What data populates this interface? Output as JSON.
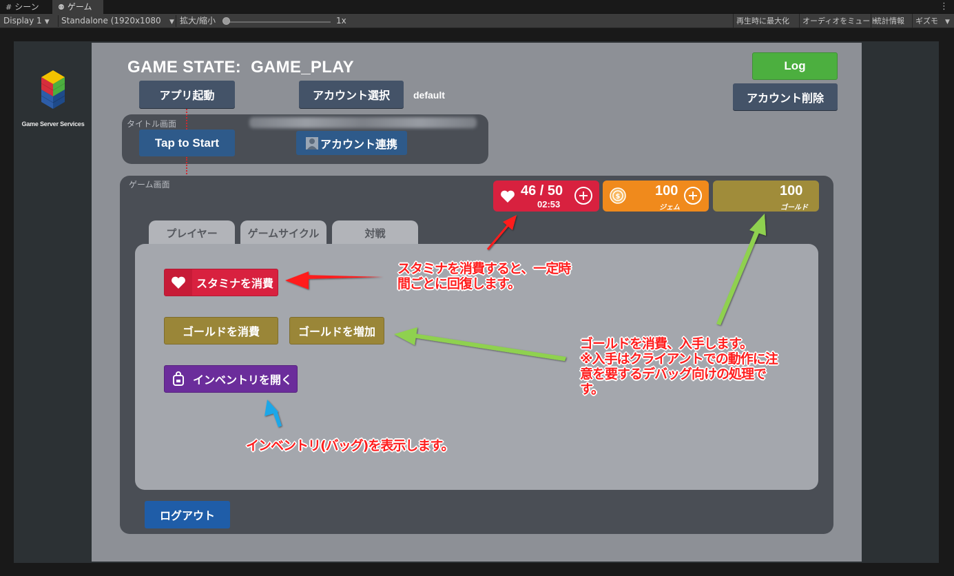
{
  "editor": {
    "tabs": [
      {
        "icon": "grid-icon",
        "label": "シーン"
      },
      {
        "icon": "gamepad-icon",
        "label": "ゲーム"
      }
    ],
    "display": "Display 1",
    "resolution": "Standalone (1920x1080",
    "zoom_label": "拡大/縮小",
    "zoom_value": "1x",
    "maximize_on_play": "再生時に最大化",
    "mute_audio": "オーディオをミュート",
    "stats": "統計情報",
    "gizmos": "ギズモ"
  },
  "sidebar": {
    "logo_label": "Game Server Services"
  },
  "game": {
    "state_label": "GAME STATE:",
    "state_value": "GAME_PLAY",
    "log_button": "Log",
    "delete_account_button": "アカウント削除",
    "launch_button": "アプリ起動",
    "select_account_button": "アカウント選択",
    "account_name": "default",
    "title_panel_label": "タイトル画面",
    "tap_to_start": "Tap to Start",
    "link_account_button": "アカウント連携",
    "game_panel_label": "ゲーム画面",
    "stamina": {
      "current_max": "46 / 50",
      "timer": "02:53"
    },
    "gem": {
      "value": "100",
      "label": "ジェム"
    },
    "gold": {
      "value": "100",
      "label": "ゴールド"
    },
    "tabs": [
      "プレイヤー",
      "ゲームサイクル",
      "対戦"
    ],
    "consume_stamina_button": "スタミナを消費",
    "consume_gold_button": "ゴールドを消費",
    "add_gold_button": "ゴールドを増加",
    "open_inventory_button": "インベントリを開く",
    "logout_button": "ログアウト"
  },
  "annotations": {
    "stamina_line1": "スタミナを消費すると、一定時",
    "stamina_line2": "間ごとに回復します。",
    "gold_line1": "ゴールドを消費、入手します。",
    "gold_line2": "※入手はクライアントでの動作に注",
    "gold_line3": "意を要するデバッグ向けの処理で",
    "gold_line4": "す。",
    "inventory": "インベントリ(バッグ)を表示します。"
  },
  "colors": {
    "stamina_red": "#d8213f",
    "gem_orange": "#f08a1c",
    "gold": "#a08c3a",
    "inventory_purple": "#6b2d9b",
    "log_green": "#4caf3f",
    "annotation_red": "#ff1e1e",
    "arrow_green": "#8fd14f",
    "arrow_cyan": "#1ea7e8"
  }
}
